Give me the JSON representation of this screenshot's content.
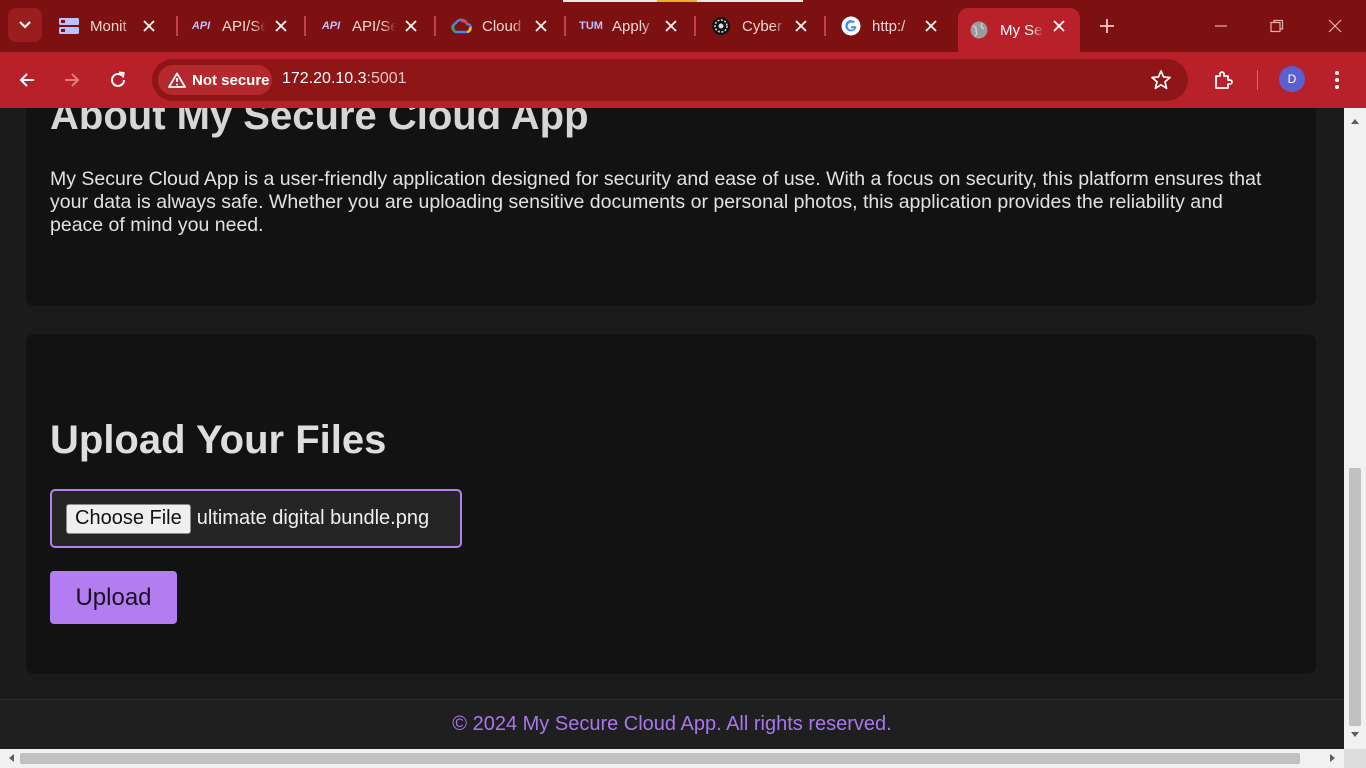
{
  "browser": {
    "tabs": [
      {
        "label": "Monit",
        "icon": "dashboard-icon"
      },
      {
        "label": "API/Se",
        "icon": "api-icon"
      },
      {
        "label": "API/Se",
        "icon": "api-icon"
      },
      {
        "label": "Cloud",
        "icon": "google-cloud-icon"
      },
      {
        "label": "Apply",
        "icon": "tum-icon"
      },
      {
        "label": "Cyber",
        "icon": "cyber-icon"
      },
      {
        "label": "http:/",
        "icon": "google-icon"
      },
      {
        "label": "My Se",
        "icon": "globe-icon",
        "active": true
      }
    ],
    "tab_icon_texts": {
      "api": "API",
      "tum": "TUM"
    },
    "security_chip": "Not secure",
    "url_host": "172.20.10.3",
    "url_port": ":5001",
    "profile_initial": "D",
    "accent": "#b9212a"
  },
  "page": {
    "about": {
      "title": "About My Secure Cloud App",
      "text": "My Secure Cloud App is a user-friendly application designed for security and ease of use. With a focus on security, this platform ensures that your data is always safe. Whether you are uploading sensitive documents or personal photos, this application provides the reliability and peace of mind you need."
    },
    "upload": {
      "title": "Upload Your Files",
      "choose_label": "Choose File",
      "file_name": "ultimate digital bundle.png",
      "button_label": "Upload",
      "accent": "#b27df1"
    },
    "footer": "© 2024 My Secure Cloud App. All rights reserved."
  }
}
